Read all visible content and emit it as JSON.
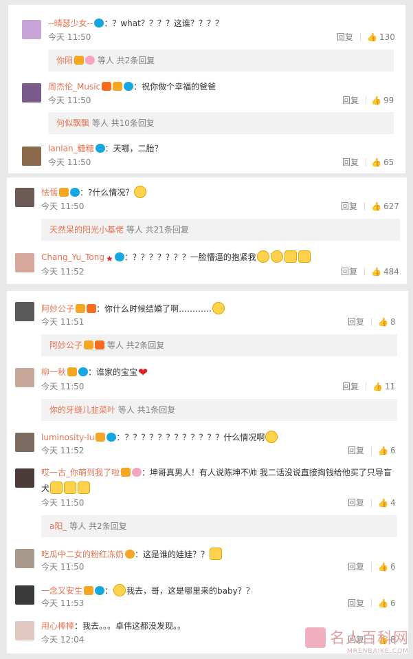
{
  "panel1": {
    "comments": [
      {
        "user": "--晴瑟少女--",
        "text": "？what？？？？这谁？？？？",
        "time": "今天 11:50",
        "reply": "回复",
        "likes": "130"
      },
      {
        "user": "周杰伦_Music",
        "text": "祝你做个幸福的爸爸",
        "time": "今天 11:50",
        "reply": "回复",
        "likes": "99"
      },
      {
        "user": "lanlan_糖糖",
        "text": "天哪，二胎？",
        "time": "今天 11:50",
        "reply": "回复",
        "likes": "65"
      }
    ],
    "subs": [
      {
        "name": "你阳",
        "suffix": "等人 共2条回复"
      },
      {
        "name": "何似飘飘",
        "suffix": "等人 共10条回复"
      }
    ]
  },
  "panel2": {
    "comments": [
      {
        "user": "怯懦",
        "text": "?什么情况？",
        "time": "今天 11:50",
        "reply": "回复",
        "likes": "627"
      },
      {
        "user": "Chang_Yu_Tong",
        "text": "？？？？？？？一脸懵逼的抱紧我",
        "time": "今天 11:52",
        "reply": "回复",
        "likes": "484"
      }
    ],
    "subs": [
      {
        "name": "天然呆的阳光小基佬",
        "suffix": "等人 共21条回复"
      }
    ]
  },
  "panel3": {
    "comments": [
      {
        "user": "阿妙公子",
        "text": "你什么时候结婚了啊…………",
        "time": "今天 11:51",
        "reply": "回复",
        "likes": "8"
      },
      {
        "user": "柳一秋",
        "text": "谁家的宝宝",
        "time": "今天 11:50",
        "reply": "回复",
        "likes": "11"
      },
      {
        "user": "luminosity-lu",
        "text": "？？？？？？？？？？？？什么情况啊",
        "time": "今天 11:52",
        "reply": "回复",
        "likes": "6"
      },
      {
        "user": "哎一古_你萌到我了啦",
        "text": "坤哥真男人！有人说陈坤不帅 我二话没说直接掏钱给他买了只导盲",
        "text2": "犬",
        "time": "今天 11:50",
        "reply": "回复",
        "likes": "4"
      },
      {
        "user": "吃瓜中二女的粉红冻奶",
        "text": "这是谁的娃娃？？",
        "time": "今天 11:50",
        "reply": "回复",
        "likes": "6"
      },
      {
        "user": "一念又安生",
        "text": "我去，哥，这是哪里来的baby？？",
        "time": "今天 11:53",
        "reply": "回复",
        "likes": "6"
      },
      {
        "user": "用心棒棒",
        "text": "我去。。。卓伟这都没发现。。",
        "time": "今天 12:04",
        "reply": "回复",
        "likes": "8"
      }
    ],
    "subs": [
      {
        "name": "阿妙公子",
        "suffix": "等人 共2条回复"
      },
      {
        "name": "你的牙缝儿韭菜叶",
        "suffix": "等人 共1条回复"
      },
      {
        "name": "a阳_",
        "suffix": "等人 共2条回复"
      }
    ]
  },
  "colon": "：",
  "watermark": {
    "main": "名人百科网",
    "sub": "MRENBAIKE.COM"
  },
  "icons": {
    "like": "thumbs-up-icon",
    "badge_v": "verified-icon",
    "badge_vip": "vip-icon",
    "badge_fan": "fan-icon"
  }
}
